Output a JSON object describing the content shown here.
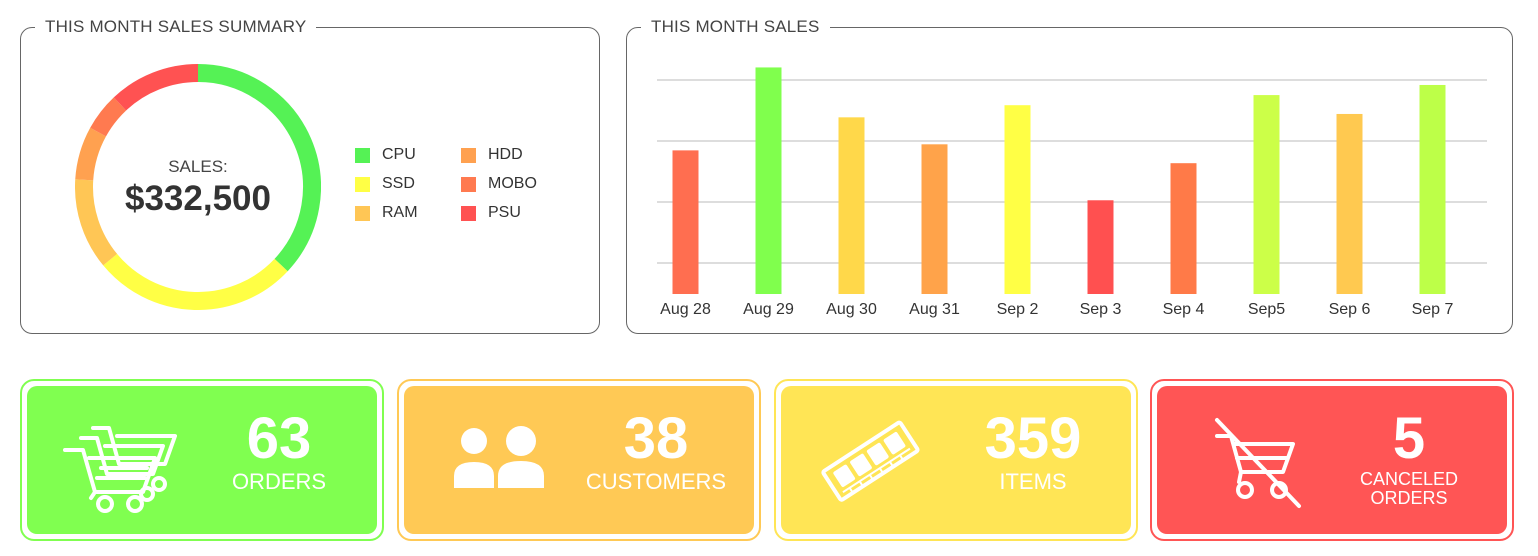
{
  "summary": {
    "title": "THIS MONTH SALES SUMMARY",
    "center_label": "SALES:",
    "center_value": "$332,500",
    "legend": [
      {
        "label": "CPU",
        "color": "#55f255"
      },
      {
        "label": "SSD",
        "color": "#ffff45"
      },
      {
        "label": "RAM",
        "color": "#ffc655"
      },
      {
        "label": "HDD",
        "color": "#ffa150"
      },
      {
        "label": "MOBO",
        "color": "#ff7a50"
      },
      {
        "label": "PSU",
        "color": "#ff5252"
      }
    ],
    "chart_data": {
      "type": "pie",
      "categories": [
        "CPU",
        "SSD",
        "RAM",
        "HDD",
        "MOBO",
        "PSU"
      ],
      "values": [
        37,
        27,
        12,
        7,
        5,
        12
      ],
      "title": "THIS MONTH SALES SUMMARY"
    }
  },
  "sales": {
    "title": "THIS MONTH SALES",
    "chart_data": {
      "type": "bar",
      "categories": [
        "Aug 28",
        "Aug 29",
        "Aug 30",
        "Aug 31",
        "Sep 2",
        "Sep 3",
        "Sep 4",
        "Sep5",
        "Sep 6",
        "Sep 7"
      ],
      "values": [
        213,
        336,
        262,
        222,
        280,
        139,
        194,
        295,
        267,
        310
      ],
      "colors": [
        "#ff6e50",
        "#80ff4d",
        "#ffd84a",
        "#ffa34a",
        "#ffff45",
        "#ff5050",
        "#ff7a48",
        "#ccff48",
        "#ffc950",
        "#bdff48"
      ],
      "ylim": [
        0,
        350
      ],
      "grid": true,
      "title": "THIS MONTH SALES"
    }
  },
  "stats": [
    {
      "number": "63",
      "label": "ORDERS",
      "icon": "shopping-carts-icon",
      "fill": "#80ff50",
      "border": "#80ff50"
    },
    {
      "number": "38",
      "label": "CUSTOMERS",
      "icon": "users-icon",
      "fill": "#ffc955",
      "border": "#ffc955"
    },
    {
      "number": "359",
      "label": "ITEMS",
      "icon": "ram-module-icon",
      "fill": "#ffe555",
      "border": "#ffe555"
    },
    {
      "number": "5",
      "label": "CANCELED ORDERS",
      "icon": "canceled-cart-icon",
      "fill": "#ff5555",
      "border": "#ff5555"
    }
  ]
}
